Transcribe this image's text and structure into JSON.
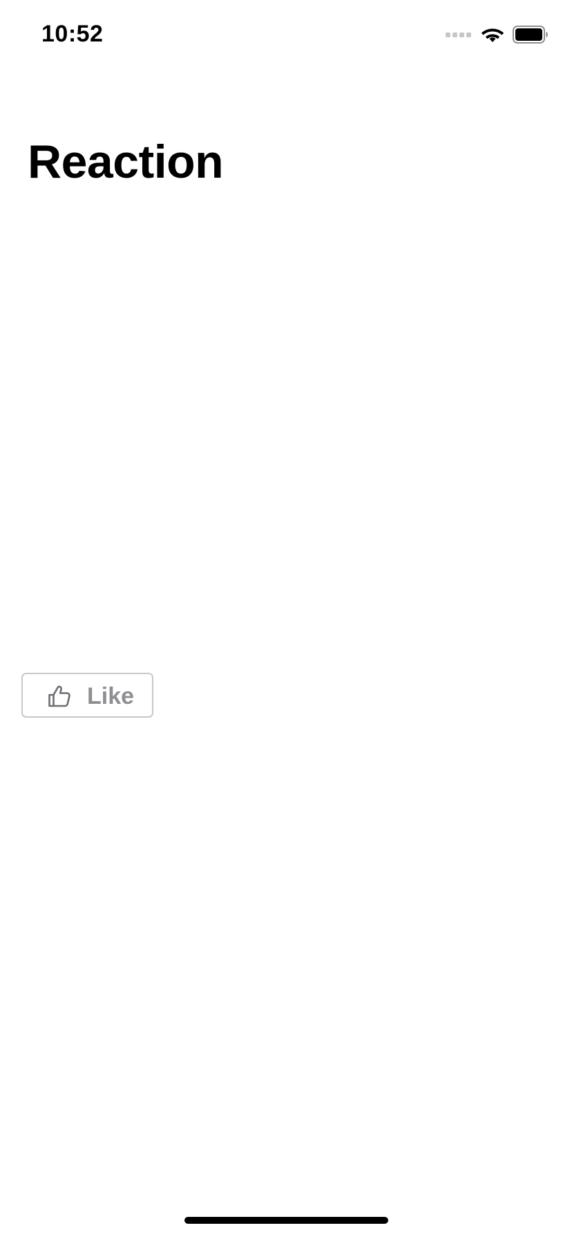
{
  "status_bar": {
    "time": "10:52",
    "icons": [
      "cellular-signal-icon",
      "wifi-icon",
      "battery-icon"
    ]
  },
  "page": {
    "title": "Reaction"
  },
  "reaction": {
    "like_label": "Like",
    "icon": "thumbs-up-icon",
    "liked": false
  },
  "colors": {
    "background": "#ffffff",
    "title": "#000000",
    "button_border": "#c7c7cc",
    "button_text": "#8e8e93"
  }
}
